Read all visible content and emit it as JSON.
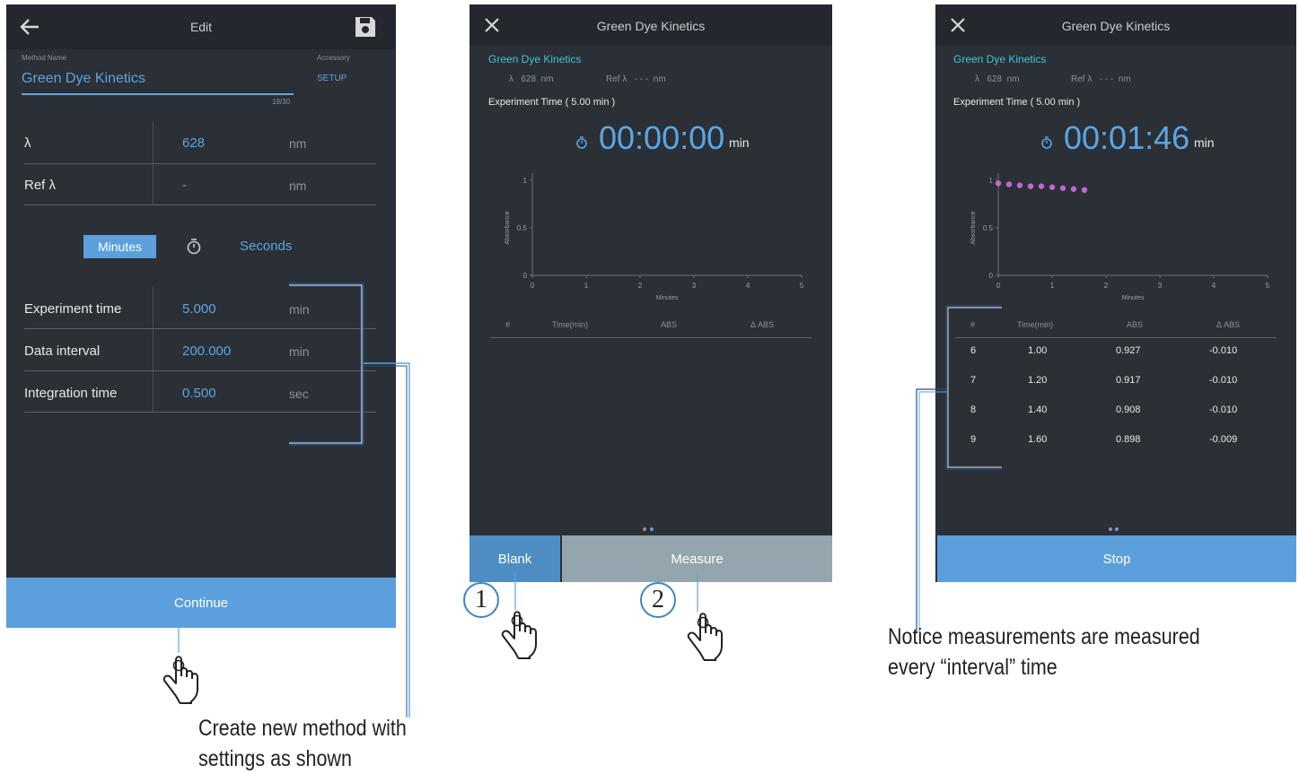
{
  "screen1": {
    "title": "Edit",
    "method_name_label": "Method Name",
    "method_name_value": "Green Dye Kinetics",
    "accessory_label": "Accessory",
    "setup_label": "SETUP",
    "char_count": "18/30",
    "rows_top": [
      {
        "label": "λ",
        "value": "628",
        "unit": "nm"
      },
      {
        "label": "Ref λ",
        "value": "-",
        "unit": "nm"
      }
    ],
    "minutes_label": "Minutes",
    "seconds_label": "Seconds",
    "rows_time": [
      {
        "label": "Experiment time",
        "value": "5.000",
        "unit": "min"
      },
      {
        "label": "Data interval",
        "value": "200.000",
        "unit": "min"
      },
      {
        "label": "Integration time",
        "value": "0.500",
        "unit": "sec"
      }
    ],
    "continue_label": "Continue"
  },
  "screen2": {
    "title": "Green Dye Kinetics",
    "method": "Green Dye Kinetics",
    "lambda_line": "λ   628  nm",
    "ref_line": "Ref λ   - - -  nm",
    "exp_time": "Experiment Time ( 5.00 min )",
    "timer": "00:00:00",
    "timer_unit": "min",
    "table_headers": [
      "#",
      "Time(min)",
      "ABS",
      "Δ ABS"
    ],
    "blank_label": "Blank",
    "measure_label": "Measure"
  },
  "screen3": {
    "title": "Green Dye Kinetics",
    "method": "Green Dye Kinetics",
    "lambda_line": "λ   628  nm",
    "ref_line": "Ref λ   - - -  nm",
    "exp_time": "Experiment Time ( 5.00 min )",
    "timer": "00:01:46",
    "timer_unit": "min",
    "table_headers": [
      "#",
      "Time(min)",
      "ABS",
      "Δ ABS"
    ],
    "table_rows": [
      [
        "6",
        "1.00",
        "0.927",
        "-0.010"
      ],
      [
        "7",
        "1.20",
        "0.917",
        "-0.010"
      ],
      [
        "8",
        "1.40",
        "0.908",
        "-0.010"
      ],
      [
        "9",
        "1.60",
        "0.898",
        "-0.009"
      ]
    ],
    "stop_label": "Stop"
  },
  "chart_data": [
    {
      "type": "scatter",
      "xlabel": "Minutes",
      "ylabel": "Absorbance",
      "xlim": [
        0,
        5
      ],
      "ylim": [
        0,
        1
      ],
      "x_ticks": [
        "0",
        "1",
        "2",
        "3",
        "4",
        "5"
      ],
      "y_ticks": [
        "0",
        "0.5",
        "1"
      ],
      "series": [
        {
          "x": [],
          "y": []
        }
      ]
    },
    {
      "type": "scatter",
      "xlabel": "Minutes",
      "ylabel": "Absorbance",
      "xlim": [
        0,
        5
      ],
      "ylim": [
        0,
        1
      ],
      "x_ticks": [
        "0",
        "1",
        "2",
        "3",
        "4",
        "5"
      ],
      "y_ticks": [
        "0",
        "0.5",
        "1"
      ],
      "series": [
        {
          "x": [
            0,
            0.2,
            0.4,
            0.6,
            0.8,
            1.0,
            1.2,
            1.4,
            1.6
          ],
          "y": [
            0.967,
            0.957,
            0.947,
            0.937,
            0.937,
            0.927,
            0.917,
            0.908,
            0.898
          ],
          "color": "#c466d1"
        }
      ]
    }
  ],
  "callouts": {
    "circle1": "1",
    "circle2": "2",
    "create_line1": "Create new method with",
    "create_line2": "settings as shown",
    "notice_line1": "Notice measurements are measured",
    "notice_line2": "every “interval” time"
  },
  "icons": {
    "back": "back-arrow-icon",
    "save": "save-icon",
    "close": "close-icon",
    "stopwatch": "stopwatch-icon",
    "hand": "pointing-hand-icon"
  },
  "colors": {
    "screen_bg": "#2b2f36",
    "accent_blue": "#5aa7e3",
    "button_blue": "#5b9fdc",
    "cyan": "#3fc7d7",
    "marker": "#c466d1"
  }
}
